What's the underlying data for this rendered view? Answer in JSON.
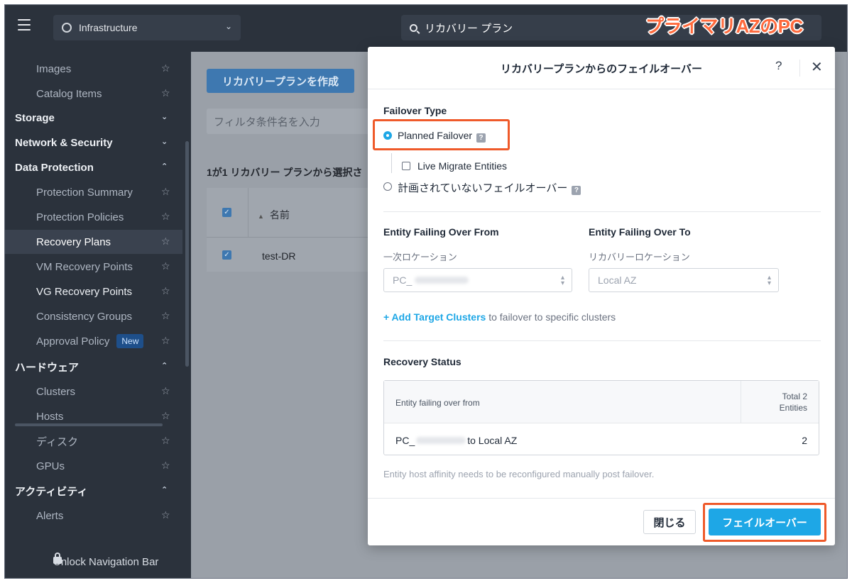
{
  "topbar": {
    "app_selector": "Infrastructure",
    "search_value": "リカバリー プラン",
    "banner": "プライマリAZのPC"
  },
  "sidebar": {
    "items": [
      {
        "label": "Images",
        "type": "sub"
      },
      {
        "label": "Catalog Items",
        "type": "sub"
      },
      {
        "label": "Storage",
        "type": "group",
        "expanded": false
      },
      {
        "label": "Network & Security",
        "type": "group",
        "expanded": false
      },
      {
        "label": "Data Protection",
        "type": "group",
        "expanded": true
      },
      {
        "label": "Protection Summary",
        "type": "sub"
      },
      {
        "label": "Protection Policies",
        "type": "sub"
      },
      {
        "label": "Recovery Plans",
        "type": "sub",
        "active": true
      },
      {
        "label": "VM Recovery Points",
        "type": "sub"
      },
      {
        "label": "VG Recovery Points",
        "type": "sub"
      },
      {
        "label": "Consistency Groups",
        "type": "sub"
      },
      {
        "label": "Approval Policy",
        "type": "sub",
        "badge": "New"
      },
      {
        "label": "ハードウェア",
        "type": "group",
        "expanded": true
      },
      {
        "label": "Clusters",
        "type": "sub"
      },
      {
        "label": "Hosts",
        "type": "sub"
      },
      {
        "label": "ディスク",
        "type": "sub"
      },
      {
        "label": "GPUs",
        "type": "sub"
      },
      {
        "label": "アクティビティ",
        "type": "group",
        "expanded": true
      },
      {
        "label": "Alerts",
        "type": "sub"
      }
    ],
    "unlock_label": "Unlock Navigation Bar"
  },
  "main": {
    "create_button": "リカバリープランを作成",
    "filter_placeholder": "フィルタ条件名を入力",
    "selection_text": "1が1 リカバリー プランから選択さ",
    "column_name": "名前",
    "rows": [
      {
        "name": "test-DR",
        "checked": true
      }
    ]
  },
  "modal": {
    "title": "リカバリープランからのフェイルオーバー",
    "failover_type_title": "Failover Type",
    "planned_label": "Planned Failover",
    "live_migrate_label": "Live Migrate Entities",
    "unplanned_label": "計画されていないフェイルオーバー",
    "from_title": "Entity Failing Over From",
    "from_sublabel": "一次ロケーション",
    "from_value": "PC_",
    "to_title": "Entity Failing Over To",
    "to_sublabel": "リカバリーロケーション",
    "to_value": "Local AZ",
    "add_clusters_link": "+ Add Target Clusters",
    "add_clusters_rest": "to failover to specific clusters",
    "recovery_status_title": "Recovery Status",
    "status_col1": "Entity failing over from",
    "status_col2_line1": "Total 2",
    "status_col2_line2": "Entities",
    "status_row_prefix": "PC_",
    "status_row_suffix": "to Local AZ",
    "status_row_count": "2",
    "note": "Entity host affinity needs to be reconfigured manually post failover.",
    "close_button": "閉じる",
    "failover_button": "フェイルオーバー"
  },
  "colors": {
    "accent": "#1ea7e6",
    "highlight": "#ef5a2a",
    "sidebar_bg": "#2b323c"
  }
}
